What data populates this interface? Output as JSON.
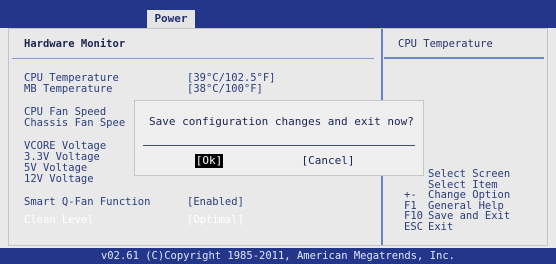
{
  "top": {
    "tab": "Power"
  },
  "main": {
    "heading": "Hardware Monitor",
    "rows": [
      {
        "label": "CPU Temperature",
        "value": "[39°C/102.5°F]"
      },
      {
        "label": "MB Temperature",
        "value": "[38°C/100°F]"
      },
      {
        "label": "CPU Fan Speed",
        "value": ""
      },
      {
        "label": "Chassis Fan Spee",
        "value": ""
      },
      {
        "label": "VCORE Voltage",
        "value": ""
      },
      {
        "label": "3.3V Voltage",
        "value": ""
      },
      {
        "label": "5V Voltage",
        "value": ""
      },
      {
        "label": "12V Voltage",
        "value": ""
      },
      {
        "label": "Smart Q-Fan Function",
        "value": "[Enabled]"
      },
      {
        "label": "Clean Level",
        "value": "[Optimal]"
      }
    ]
  },
  "side": {
    "heading": "CPU Temperature",
    "keys": [
      {
        "key": "",
        "desc": "Select Screen"
      },
      {
        "key": "",
        "desc": "Select Item"
      },
      {
        "key": "+-",
        "desc": "Change Option"
      },
      {
        "key": "F1",
        "desc": "General Help"
      },
      {
        "key": "F10",
        "desc": "Save and Exit"
      },
      {
        "key": "ESC",
        "desc": "Exit"
      }
    ]
  },
  "dialog": {
    "message": "Save configuration changes and exit now?",
    "ok": "[Ok]",
    "cancel": "[Cancel]"
  },
  "footer": {
    "text": "v02.61 (C)Copyright 1985-2011, American Megatrends, Inc."
  }
}
